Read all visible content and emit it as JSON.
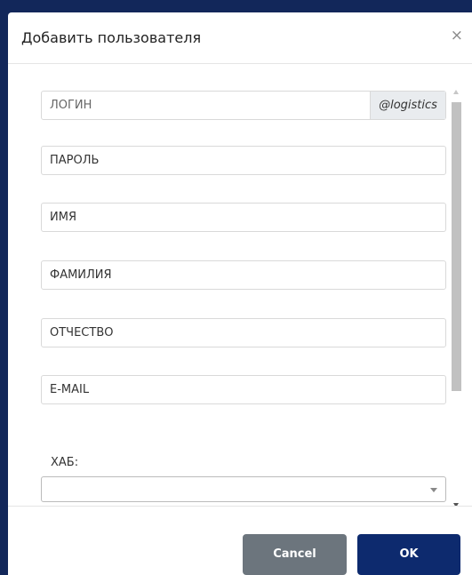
{
  "dialog": {
    "title": "Добавить пользователя",
    "close_glyph": "×"
  },
  "form": {
    "login": {
      "placeholder": "ЛОГИН",
      "suffix": "@logistics"
    },
    "password": {
      "placeholder": "ПАРОЛЬ"
    },
    "first_name": {
      "placeholder": "ИМЯ"
    },
    "last_name": {
      "placeholder": "ФАМИЛИЯ"
    },
    "middle_name": {
      "placeholder": "ОТЧЕСТВО"
    },
    "email": {
      "placeholder": "E-MAIL"
    },
    "hub": {
      "label": "ХАБ:",
      "value": ""
    }
  },
  "footer": {
    "cancel_label": "Cancel",
    "ok_label": "OK"
  },
  "icons": {
    "close": "close-icon",
    "select_arrow": "chevron-down-icon"
  },
  "colors": {
    "backdrop": "#12275a",
    "ok_button": "#0d2a6e",
    "cancel_button": "#6c757d",
    "addon_bg": "#e9ecef"
  }
}
